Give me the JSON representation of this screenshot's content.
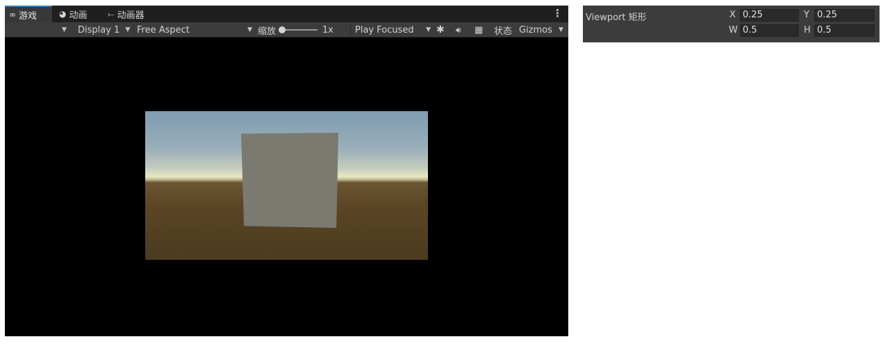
{
  "tabs": [
    {
      "label": "游戏",
      "icon": "gamepad-icon",
      "glyph": "∞"
    },
    {
      "label": "动画",
      "icon": "clock-icon",
      "glyph": "◕"
    },
    {
      "label": "动画器",
      "icon": "animator-icon",
      "glyph": "⤚"
    }
  ],
  "toolbar": {
    "display": "Display 1",
    "aspect": "Free Aspect",
    "zoom_label": "缩放",
    "zoom_value": "1x",
    "zoom_level": 1,
    "play_mode": "Play Focused",
    "stats": "状态",
    "gizmos": "Gizmos"
  },
  "viewport_rect": {
    "label": "Viewport 矩形",
    "x_label": "X",
    "x": "0.25",
    "y_label": "Y",
    "y": "0.25",
    "w_label": "W",
    "w": "0.5",
    "h_label": "H",
    "h": "0.5"
  },
  "colors": {
    "tab_bar": "#1f1f1f",
    "toolbar": "#3c3c3c",
    "game_background": "#000000",
    "cube": "#7a7a71",
    "ground": "#5c4626",
    "sky": "#8fa6b6"
  }
}
